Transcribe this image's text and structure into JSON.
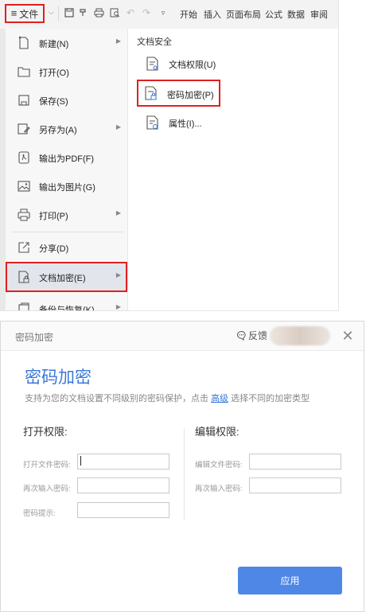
{
  "ribbon": {
    "file_button_label": "文件",
    "tabs": [
      "开始",
      "插入",
      "页面布局",
      "公式",
      "数据",
      "审阅"
    ]
  },
  "file_menu": {
    "items": [
      {
        "label": "新建(N)",
        "icon": "new-file-icon",
        "has_submenu": true
      },
      {
        "label": "打开(O)",
        "icon": "folder-open-icon",
        "has_submenu": false
      },
      {
        "label": "保存(S)",
        "icon": "save-icon",
        "has_submenu": false
      },
      {
        "label": "另存为(A)",
        "icon": "save-as-icon",
        "has_submenu": true
      },
      {
        "label": "输出为PDF(F)",
        "icon": "pdf-icon",
        "has_submenu": false
      },
      {
        "label": "输出为图片(G)",
        "icon": "image-icon",
        "has_submenu": false
      },
      {
        "label": "打印(P)",
        "icon": "print-icon",
        "has_submenu": true
      },
      {
        "label": "分享(D)",
        "icon": "share-icon",
        "has_submenu": false
      },
      {
        "label": "文档加密(E)",
        "icon": "document-lock-icon",
        "has_submenu": true,
        "highlighted": true
      },
      {
        "label": "备份与恢复(K)",
        "icon": "backup-icon",
        "has_submenu": true
      }
    ]
  },
  "submenu": {
    "title": "文档安全",
    "items": [
      {
        "label": "文档权限(U)",
        "icon": "doc-permission-icon"
      },
      {
        "label": "密码加密(P)",
        "icon": "doc-password-icon",
        "highlighted": true
      },
      {
        "label": "属性(I)...",
        "icon": "doc-properties-icon"
      }
    ]
  },
  "dialog": {
    "window_title": "密码加密",
    "feedback_label": "反馈",
    "title": "密码加密",
    "description_before": "支持为您的文档设置不同级别的密码保护，点击",
    "description_link": "高级",
    "description_after": "选择不同的加密类型",
    "open_section": {
      "title": "打开权限:",
      "fields": [
        {
          "label": "打开文件密码:",
          "value": ""
        },
        {
          "label": "再次输入密码:",
          "value": ""
        },
        {
          "label": "密码提示:",
          "value": ""
        }
      ]
    },
    "edit_section": {
      "title": "编辑权限:",
      "fields": [
        {
          "label": "编辑文件密码:",
          "value": ""
        },
        {
          "label": "再次输入密码:",
          "value": ""
        }
      ]
    },
    "apply_label": "应用"
  },
  "colors": {
    "accent": "#3a79d8",
    "apply_button": "#4f87e6",
    "highlight_border": "#e02020"
  }
}
